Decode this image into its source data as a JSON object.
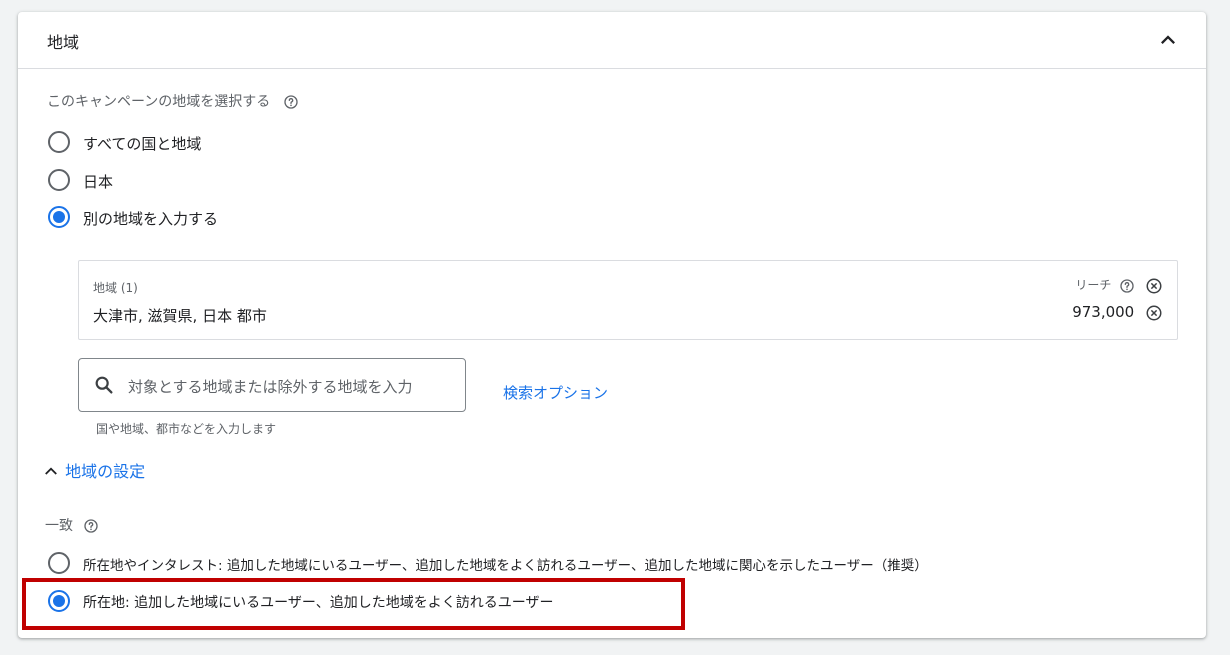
{
  "section": {
    "title": "地域",
    "question": "このキャンペーンの地域を選択する",
    "options": [
      {
        "label": "すべての国と地域",
        "selected": false
      },
      {
        "label": "日本",
        "selected": false
      },
      {
        "label": "別の地域を入力する",
        "selected": true
      }
    ]
  },
  "locations": {
    "header": "地域 (1)",
    "reach_label": "リーチ",
    "items": [
      {
        "name": "大津市, 滋賀県, 日本 都市",
        "reach": "973,000"
      }
    ]
  },
  "search": {
    "placeholder": "対象とする地域または除外する地域を入力",
    "hint": "国や地域、都市などを入力します",
    "options_link": "検索オプション"
  },
  "settings": {
    "toggle_label": "地域の設定",
    "match_label": "一致",
    "options": [
      {
        "label": "所在地やインタレスト: 追加した地域にいるユーザー、追加した地域をよく訪れるユーザー、追加した地域に関心を示したユーザー（推奨）",
        "selected": false
      },
      {
        "label": "所在地: 追加した地域にいるユーザー、追加した地域をよく訪れるユーザー",
        "selected": true
      }
    ]
  },
  "colors": {
    "accent": "#1a73e8",
    "highlight": "#c00000"
  }
}
